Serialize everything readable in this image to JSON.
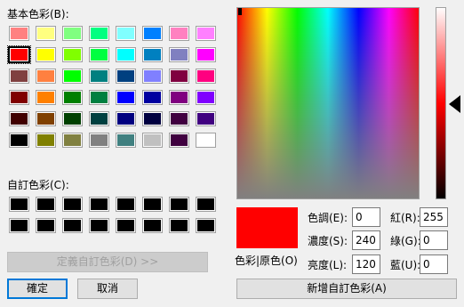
{
  "basic_colors": {
    "label": "基本色彩(B):",
    "rows": [
      [
        "#ff8080",
        "#ffff80",
        "#80ff80",
        "#00ff80",
        "#80ffff",
        "#0080ff",
        "#ff80c0",
        "#ff80ff"
      ],
      [
        "#ff0000",
        "#ffff00",
        "#80ff00",
        "#00ff40",
        "#00ffff",
        "#0080c0",
        "#8080c0",
        "#ff00ff"
      ],
      [
        "#804040",
        "#ff8040",
        "#00ff00",
        "#008080",
        "#004080",
        "#8080ff",
        "#800040",
        "#ff0080"
      ],
      [
        "#800000",
        "#ff8000",
        "#008000",
        "#008040",
        "#0000ff",
        "#0000a0",
        "#800080",
        "#8000ff"
      ],
      [
        "#400000",
        "#804000",
        "#004000",
        "#004040",
        "#000080",
        "#000040",
        "#400040",
        "#400080"
      ],
      [
        "#000000",
        "#808000",
        "#808040",
        "#808080",
        "#408080",
        "#c0c0c0",
        "#400040",
        "#ffffff"
      ]
    ],
    "selected": [
      1,
      0
    ]
  },
  "custom_colors": {
    "label": "自訂色彩(C):",
    "rows": [
      [
        "#000000",
        "#000000",
        "#000000",
        "#000000",
        "#000000",
        "#000000",
        "#000000",
        "#000000"
      ],
      [
        "#000000",
        "#000000",
        "#000000",
        "#000000",
        "#000000",
        "#000000",
        "#000000",
        "#000000"
      ]
    ]
  },
  "buttons": {
    "define_custom": "定義自訂色彩(D) >>",
    "ok": "確定",
    "cancel": "取消",
    "add_custom": "新增自訂色彩(A)"
  },
  "preview": {
    "label": "色彩|原色(O)",
    "color": "#ff0000"
  },
  "fields": {
    "hue": {
      "label": "色調(E):",
      "value": "0"
    },
    "saturation": {
      "label": "濃度(S):",
      "value": "240"
    },
    "luminance": {
      "label": "亮度(L):",
      "value": "120"
    },
    "red": {
      "label": "紅(R):",
      "value": "255"
    },
    "green": {
      "label": "綠(G):",
      "value": "0"
    },
    "blue": {
      "label": "藍(U):",
      "value": "0"
    }
  }
}
